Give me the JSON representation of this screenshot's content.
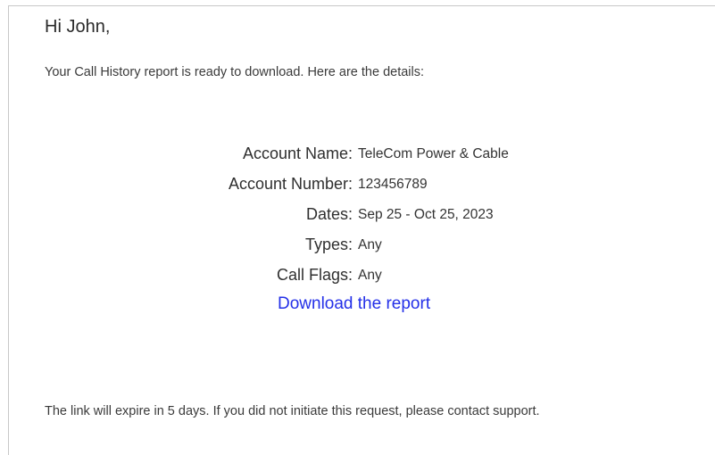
{
  "greeting": "Hi John,",
  "intro": "Your Call History report is ready to download. Here are the details:",
  "details": [
    {
      "label": "Account Name:",
      "value": "TeleCom Power & Cable"
    },
    {
      "label": "Account Number:",
      "value": "123456789"
    },
    {
      "label": "Dates:",
      "value": "Sep 25 - Oct 25, 2023"
    },
    {
      "label": "Types:",
      "value": "Any"
    },
    {
      "label": "Call Flags:",
      "value": "Any"
    }
  ],
  "download_link": "Download the report",
  "footer_note": "The link will expire in 5 days. If you did not initiate this request, please contact support.",
  "colors": {
    "link": "#2430e8",
    "text": "#333333"
  }
}
